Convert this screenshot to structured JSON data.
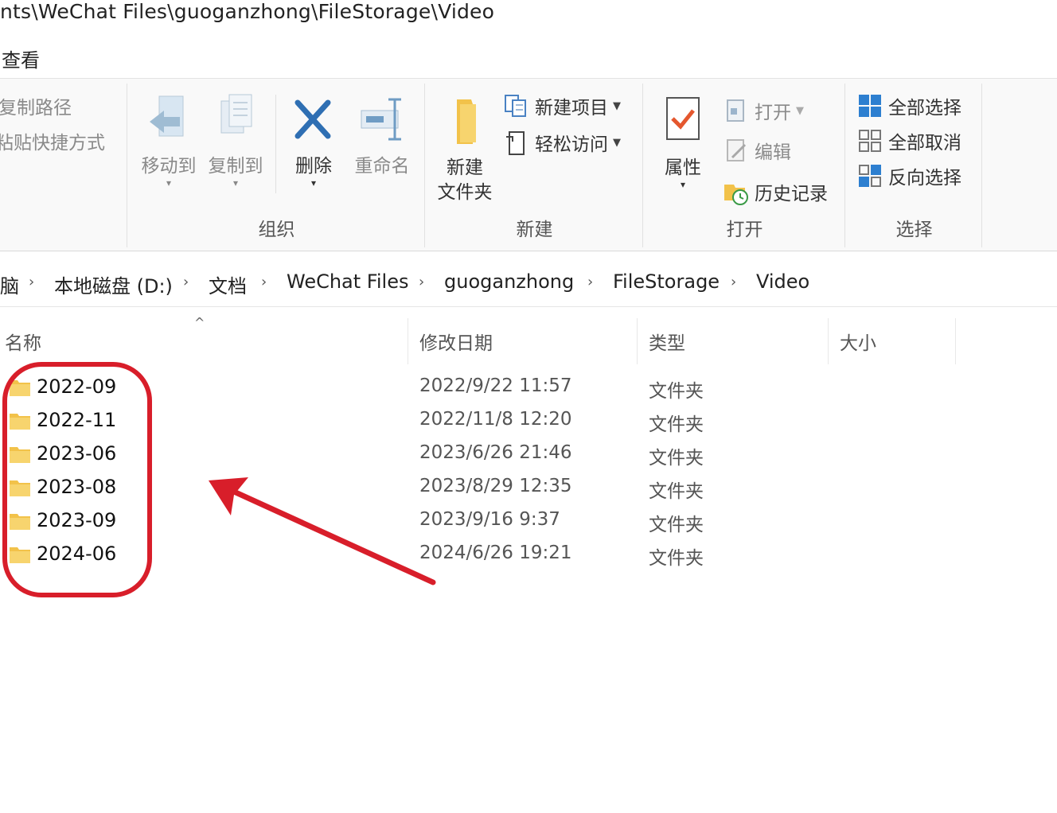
{
  "window": {
    "path_title": "nts\\WeChat Files\\guoganzhong\\FileStorage\\Video"
  },
  "menu": {
    "view_label": "查看"
  },
  "ribbon": {
    "clipboard": {
      "copy_path": "复制路径",
      "paste_shortcut": "粘贴快捷方式"
    },
    "organize": {
      "group_label": "组织",
      "move_to": "移动到",
      "copy_to": "复制到",
      "delete": "删除",
      "rename": "重命名"
    },
    "new": {
      "group_label": "新建",
      "new_folder_line1": "新建",
      "new_folder_line2": "文件夹",
      "new_item": "新建项目",
      "easy_access": "轻松访问"
    },
    "open": {
      "group_label": "打开",
      "properties": "属性",
      "open": "打开",
      "edit": "编辑",
      "history": "历史记录"
    },
    "select": {
      "group_label": "选择",
      "select_all": "全部选择",
      "select_none": "全部取消",
      "invert_selection": "反向选择"
    }
  },
  "breadcrumb": [
    "脑",
    "本地磁盘 (D:)",
    "文档",
    "WeChat Files",
    "guoganzhong",
    "FileStorage",
    "Video"
  ],
  "columns": {
    "name": "名称",
    "modified": "修改日期",
    "type": "类型",
    "size": "大小"
  },
  "files": [
    {
      "name": "2022-09",
      "modified": "2022/9/22 11:57",
      "type": "文件夹",
      "size": ""
    },
    {
      "name": "2022-11",
      "modified": "2022/11/8 12:20",
      "type": "文件夹",
      "size": ""
    },
    {
      "name": "2023-06",
      "modified": "2023/6/26 21:46",
      "type": "文件夹",
      "size": ""
    },
    {
      "name": "2023-08",
      "modified": "2023/8/29 12:35",
      "type": "文件夹",
      "size": ""
    },
    {
      "name": "2023-09",
      "modified": "2023/9/16 9:37",
      "type": "文件夹",
      "size": ""
    },
    {
      "name": "2024-06",
      "modified": "2024/6/26 19:21",
      "type": "文件夹",
      "size": ""
    }
  ],
  "colors": {
    "annotation_red": "#d81e2a",
    "folder_yellow": "#f6cf5b",
    "accent_blue": "#1a7fd8"
  },
  "icons": {
    "move_to": "arrow-left-icon",
    "copy_to": "copy-pages-icon",
    "delete": "close-x-icon",
    "rename": "rename-cursor-icon",
    "new_folder": "folder-icon",
    "new_item": "new-item-icon",
    "easy_access": "easy-access-icon",
    "properties": "checkmark-doc-icon",
    "open": "open-icon",
    "edit": "edit-icon",
    "history": "history-clock-icon",
    "select_all": "select-all-icon",
    "select_none": "select-none-icon",
    "invert": "invert-select-icon",
    "folder_row": "folder-icon",
    "sort": "chevron-up-icon",
    "separator": "chevron-right-icon"
  }
}
